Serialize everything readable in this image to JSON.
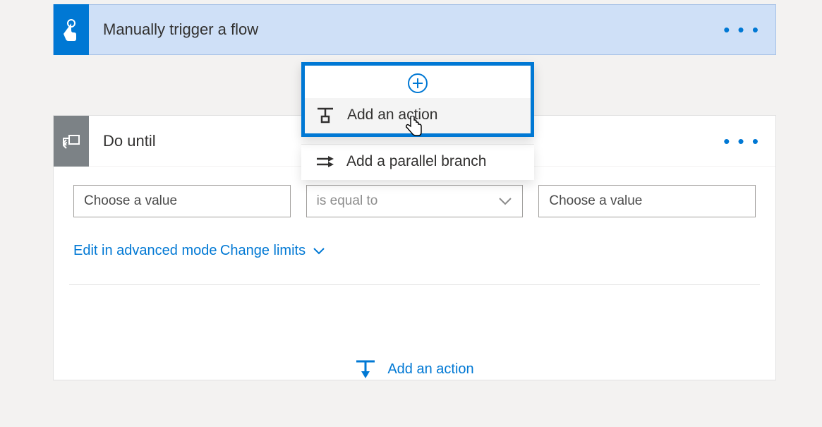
{
  "trigger": {
    "title": "Manually trigger a flow",
    "menu": "• • •"
  },
  "popup": {
    "add_action": "Add an action",
    "parallel_branch": "Add a parallel branch"
  },
  "do_until": {
    "title": "Do until",
    "menu": "• • •",
    "left_placeholder": "Choose a value",
    "operator": "is equal to",
    "right_placeholder": "Choose a value",
    "edit_advanced": "Edit in advanced mode",
    "change_limits": "Change limits",
    "inner_add_action": "Add an action"
  },
  "colors": {
    "primary": "#0078d4",
    "trigger_bg": "#cfe0f7",
    "gray": "#7c8286"
  }
}
